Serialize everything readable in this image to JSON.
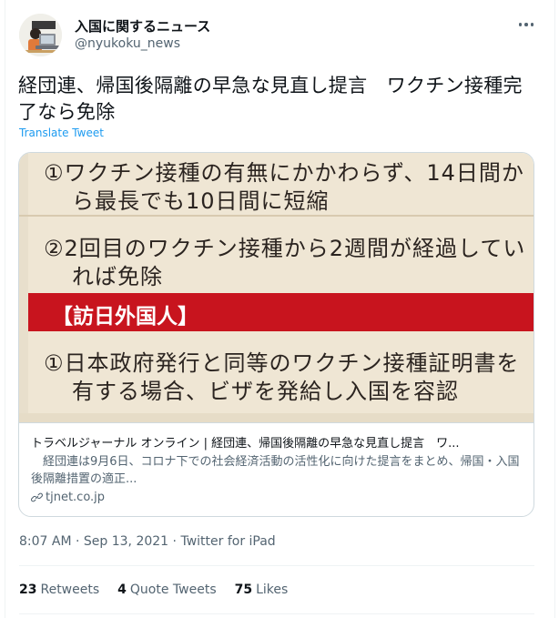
{
  "author": {
    "display_name": "入国に関するニュース",
    "handle": "@nyukoku_news",
    "avatar_icon": "laptop-person-avatar"
  },
  "tweet": {
    "text": "経団連、帰国後隔離の早急な見直し提言　ワクチン接種完了なら免除",
    "translate_label": "Translate Tweet"
  },
  "card": {
    "image": {
      "lines": [
        "①ワクチン接種の有無にかかわらず、14日間か",
        "ら最長でも10日間に短縮",
        "②2回目のワクチン接種から2週間が経過してい",
        "れば免除",
        "①日本政府発行と同等のワクチン接種証明書を",
        "有する場合、ビザを発給し入国を容認"
      ],
      "band_label": "【訪日外国人】",
      "band_color": "#c8141e"
    },
    "title": "トラベルジャーナル オンライン | 経団連、帰国後隔離の早急な見直し提言　ワ...",
    "description": "　経団連は9月6日、コロナ下での社会経済活動の活性化に向けた提言をまとめ、帰国・入国後隔離措置の適正...",
    "domain": "tjnet.co.jp"
  },
  "meta": {
    "time": "8:07 AM",
    "separator": "·",
    "date": "Sep 13, 2021",
    "source": "Twitter for iPad"
  },
  "stats": [
    {
      "count": "23",
      "label": "Retweets"
    },
    {
      "count": "4",
      "label": "Quote Tweets"
    },
    {
      "count": "75",
      "label": "Likes"
    }
  ],
  "colors": {
    "accent": "#1d9bf0",
    "text": "#0f1419",
    "secondary": "#536471"
  }
}
